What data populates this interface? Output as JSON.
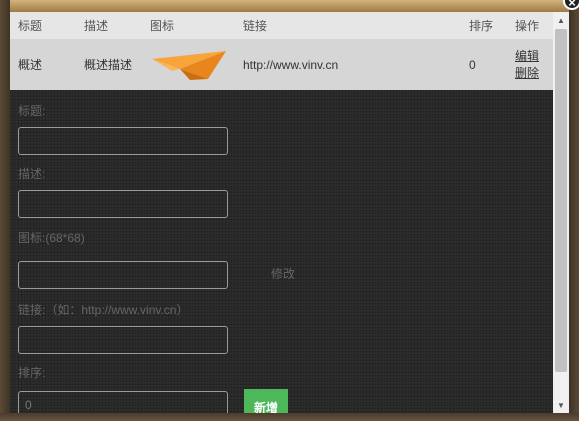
{
  "table": {
    "headers": [
      "标题",
      "描述",
      "图标",
      "链接",
      "排序",
      "操作"
    ],
    "rows": [
      {
        "title": "概述",
        "desc": "概述描述",
        "icon": "paper-plane-icon",
        "link": "http://www.vinv.cn",
        "order": "0",
        "edit": "编辑",
        "delete": "删除"
      }
    ]
  },
  "form": {
    "title_label": "标题:",
    "title_value": "",
    "desc_label": "描述:",
    "desc_value": "",
    "icon_label": "图标:(68*68)",
    "icon_value": "",
    "modify_label": "修改",
    "link_label": "链接:（如：http://www.vinv.cn）",
    "link_value": "",
    "order_label": "排序:",
    "order_value": "0",
    "add_label": "新增"
  },
  "dialog": {
    "close_label": "×"
  },
  "colors": {
    "panel_bg": "#2b2b2b",
    "header_bg": "#e6e6e6",
    "row_bg": "#d6d6d6",
    "add_button": "#4cb85a",
    "plane_orange": "#f39a2a"
  }
}
